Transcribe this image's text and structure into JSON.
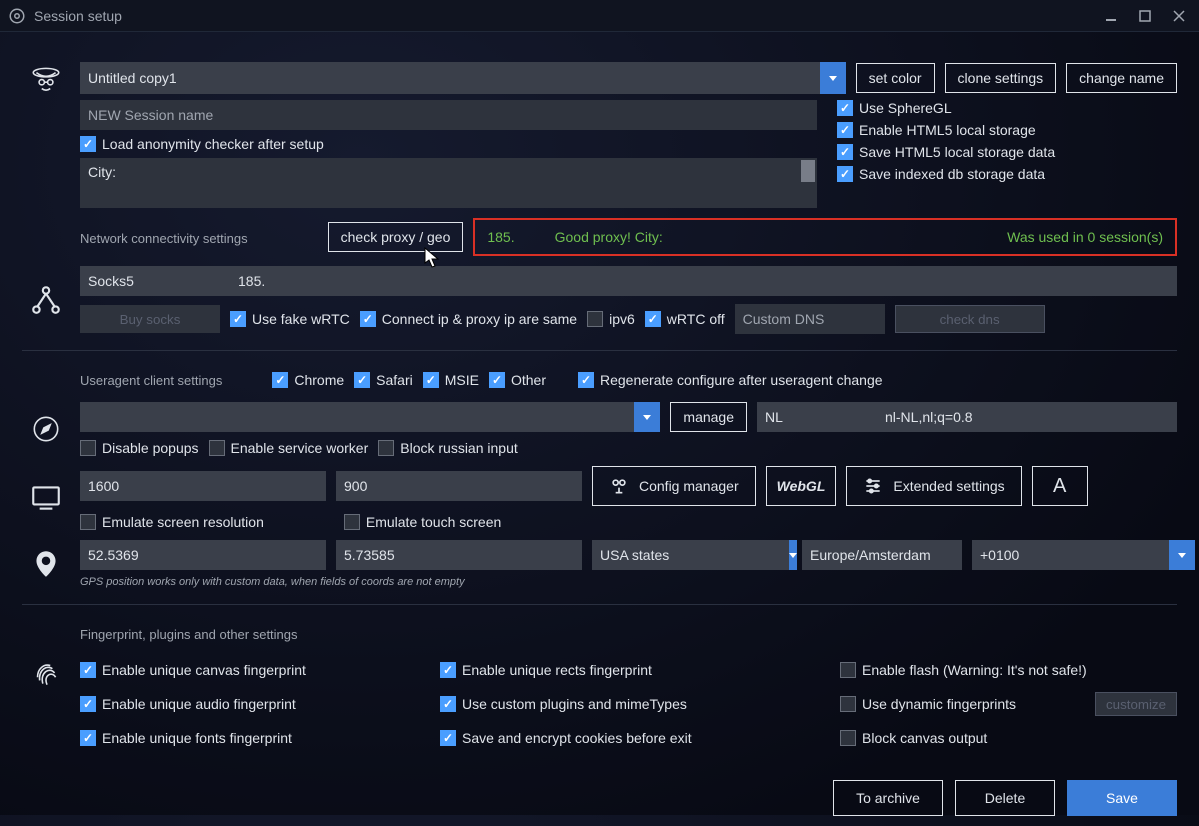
{
  "window": {
    "title": "Session setup"
  },
  "session": {
    "selected": "Untitled copy1",
    "new_name_placeholder": "NEW Session name",
    "city_label": "City:",
    "buttons": {
      "set_color": "set color",
      "clone": "clone settings",
      "change_name": "change name"
    },
    "opts": {
      "load_anonymity": "Load anonymity checker after setup",
      "use_spheregl": "Use SphereGL",
      "enable_html5_ls": "Enable HTML5 local storage",
      "save_html5_ls": "Save HTML5 local storage data",
      "save_indexed_db": "Save indexed db storage data"
    }
  },
  "network": {
    "section_label": "Network connectivity settings",
    "check_proxy_btn": "check proxy / geo",
    "status_ip": "185.",
    "status_msg": "Good proxy! City:",
    "status_used": "Was used in 0 session(s)",
    "proxy_type": "Socks5",
    "proxy_value": "185.",
    "buy_socks": "Buy socks",
    "use_fake_wrtc": "Use fake wRTC",
    "connect_same": "Connect ip & proxy ip are same",
    "ipv6": "ipv6",
    "wrtc_off": "wRTC off",
    "custom_dns_placeholder": "Custom DNS",
    "check_dns": "check dns"
  },
  "useragent": {
    "section_label": "Useragent client settings",
    "chrome": "Chrome",
    "safari": "Safari",
    "msie": "MSIE",
    "other": "Other",
    "regen": "Regenerate configure after useragent change",
    "manage": "manage",
    "lang": "NL",
    "accept": "nl-NL,nl;q=0.8",
    "disable_popups": "Disable popups",
    "enable_sw": "Enable service worker",
    "block_ru": "Block russian input"
  },
  "screen": {
    "width": "1600",
    "height": "900",
    "config_mgr": "Config manager",
    "extended": "Extended settings",
    "emulate_res": "Emulate screen resolution",
    "emulate_touch": "Emulate touch screen"
  },
  "geo": {
    "lat": "52.5369",
    "lon": "5.73585",
    "region_label": "USA states",
    "tz": "Europe/Amsterdam",
    "offset": "+0100",
    "note": "GPS position works only with custom data, when fields of coords are not empty"
  },
  "fingerprint": {
    "section_label": "Fingerprint, plugins and other settings",
    "canvas": "Enable unique canvas fingerprint",
    "audio": "Enable unique audio fingerprint",
    "fonts": "Enable unique fonts fingerprint",
    "rects": "Enable unique rects fingerprint",
    "plugins": "Use custom plugins and mimeTypes",
    "cookies": "Save and encrypt cookies before exit",
    "flash": "Enable flash (Warning: It's not safe!)",
    "dynamic": "Use dynamic fingerprints",
    "customize": "customize",
    "block_canvas": "Block canvas output"
  },
  "footer": {
    "archive": "To archive",
    "delete": "Delete",
    "save": "Save"
  }
}
